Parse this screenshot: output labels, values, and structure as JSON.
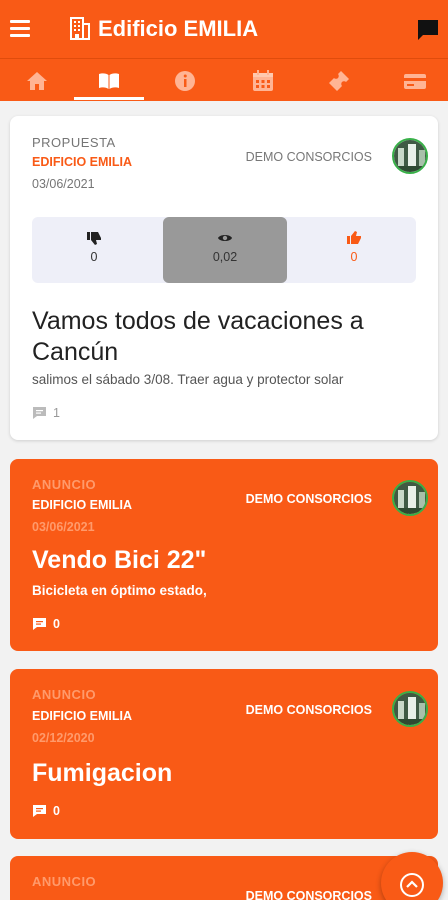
{
  "app": {
    "title": "Edificio EMILIA"
  },
  "colors": {
    "accent": "#f95a16",
    "muted_orange": "#ff9a6b",
    "avatar_ring": "#38b048"
  },
  "header": {
    "menu_icon": "hamburger-icon",
    "building_icon": "building-icon",
    "chat_icon": "chat-icon"
  },
  "tabs": [
    {
      "icon": "home-icon",
      "active": false
    },
    {
      "icon": "book-icon",
      "active": true
    },
    {
      "icon": "info-icon",
      "active": false
    },
    {
      "icon": "calendar-icon",
      "active": false
    },
    {
      "icon": "ticket-icon",
      "active": false
    },
    {
      "icon": "card-icon",
      "active": false
    }
  ],
  "posts": [
    {
      "type": "PROPUESTA",
      "building": "EDIFICIO EMILIA",
      "date": "03/06/2021",
      "author": "DEMO CONSORCIOS",
      "votes": {
        "dislikes": "0",
        "views": "0,02",
        "likes": "0"
      },
      "title": "Vamos todos de vacaciones a Cancún",
      "description": "salimos el sábado 3/08. Traer agua y protector solar",
      "comments": "1"
    },
    {
      "type": "ANUNCIO",
      "building": "EDIFICIO EMILIA",
      "date": "03/06/2021",
      "author": "DEMO CONSORCIOS",
      "title": "Vendo Bici 22\"",
      "description": "Bicicleta en óptimo estado,",
      "comments": "0"
    },
    {
      "type": "ANUNCIO",
      "building": "EDIFICIO EMILIA",
      "date": "02/12/2020",
      "author": "DEMO CONSORCIOS",
      "title": "Fumigacion",
      "comments": "0"
    },
    {
      "type": "ANUNCIO",
      "author": "DEMO CONSORCIOS"
    }
  ],
  "scroll_top_icon": "chevron-up-circle-icon"
}
